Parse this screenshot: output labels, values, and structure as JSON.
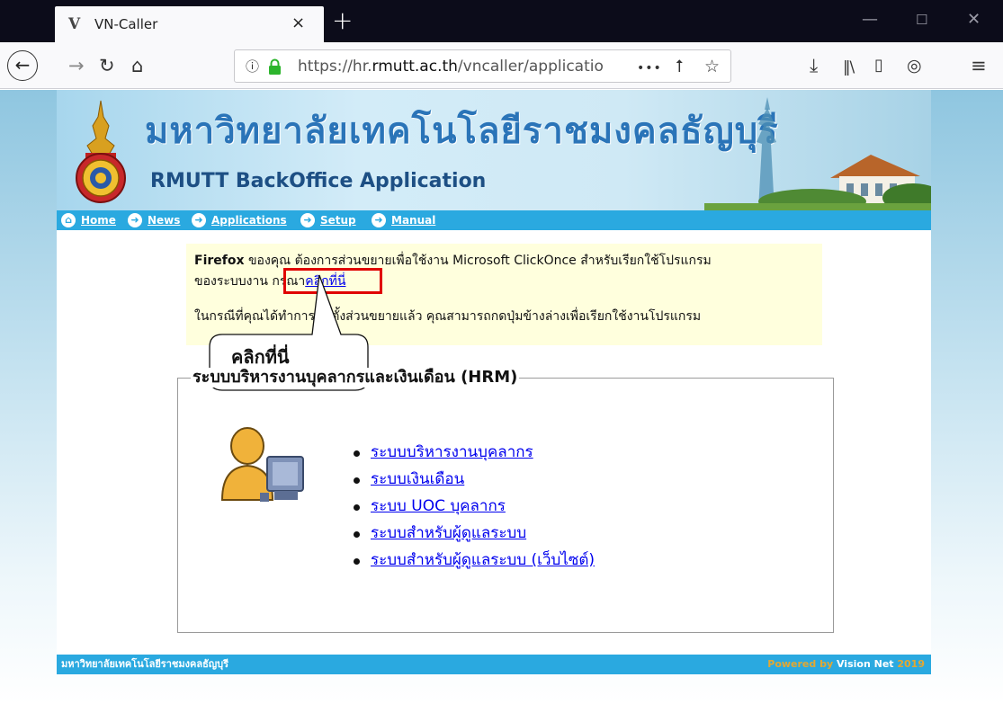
{
  "browser": {
    "tab_title": "VN-Caller",
    "tab_favicon": "V",
    "tab_close": "×",
    "new_tab": "+",
    "url_prefix": "https://hr.",
    "url_domain": "rmutt.ac.th",
    "url_path": "/vncaller/applicatio",
    "more_icon": "•••",
    "colors": {
      "tabbar": "#0c0c1a",
      "toolbar": "#f9f9fb",
      "lock": "#2db52d"
    }
  },
  "header": {
    "university_th": "มหาวิทยาลัยเทคโนโลยีราชมงคลธัญบุรี",
    "app_title": "RMUTT BackOffice Application"
  },
  "menu": {
    "items": [
      {
        "label": "Home",
        "icon": "home-icon"
      },
      {
        "label": "News",
        "icon": "arrow-circle-icon"
      },
      {
        "label": "Applications",
        "icon": "arrow-circle-icon"
      },
      {
        "label": "Setup",
        "icon": "arrow-circle-icon"
      },
      {
        "label": "Manual",
        "icon": "arrow-circle-icon"
      }
    ]
  },
  "notice": {
    "browser_name": "Firefox",
    "line1_rest": " ของคุณ ต้องการส่วนขยายเพื่อใช้งาน Microsoft ClickOnce สำหรับเรียกใช้โปรแกรม",
    "line2_prefix": "ของระบบงาน กรุณา",
    "line2_link": "คลิกที่นี่",
    "line3": "ในกรณีที่คุณได้ทำการติดตั้งส่วนขยายแล้ว คุณสามารถกดปุ่มข้างล่างเพื่อเรียกใช้งานโปรแกรม"
  },
  "callout": {
    "text": "คลิกที่นี่"
  },
  "hrm": {
    "legend": "ระบบบริหารงานบุคลากรและเงินเดือน (HRM)",
    "links": [
      "ระบบบริหารงานบุคลากร",
      "ระบบเงินเดือน",
      "ระบบ UOC บุคลากร",
      "ระบบสำหรับผู้ดูแลระบบ",
      "ระบบสำหรับผู้ดูแลระบบ (เว็บไซต์)"
    ]
  },
  "footer": {
    "left": "มหาวิทยาลัยเทคโนโลยีราชมงคลธัญบุรี",
    "powered": "Powered by ",
    "company": "Vision Net",
    "year": " 2019"
  }
}
